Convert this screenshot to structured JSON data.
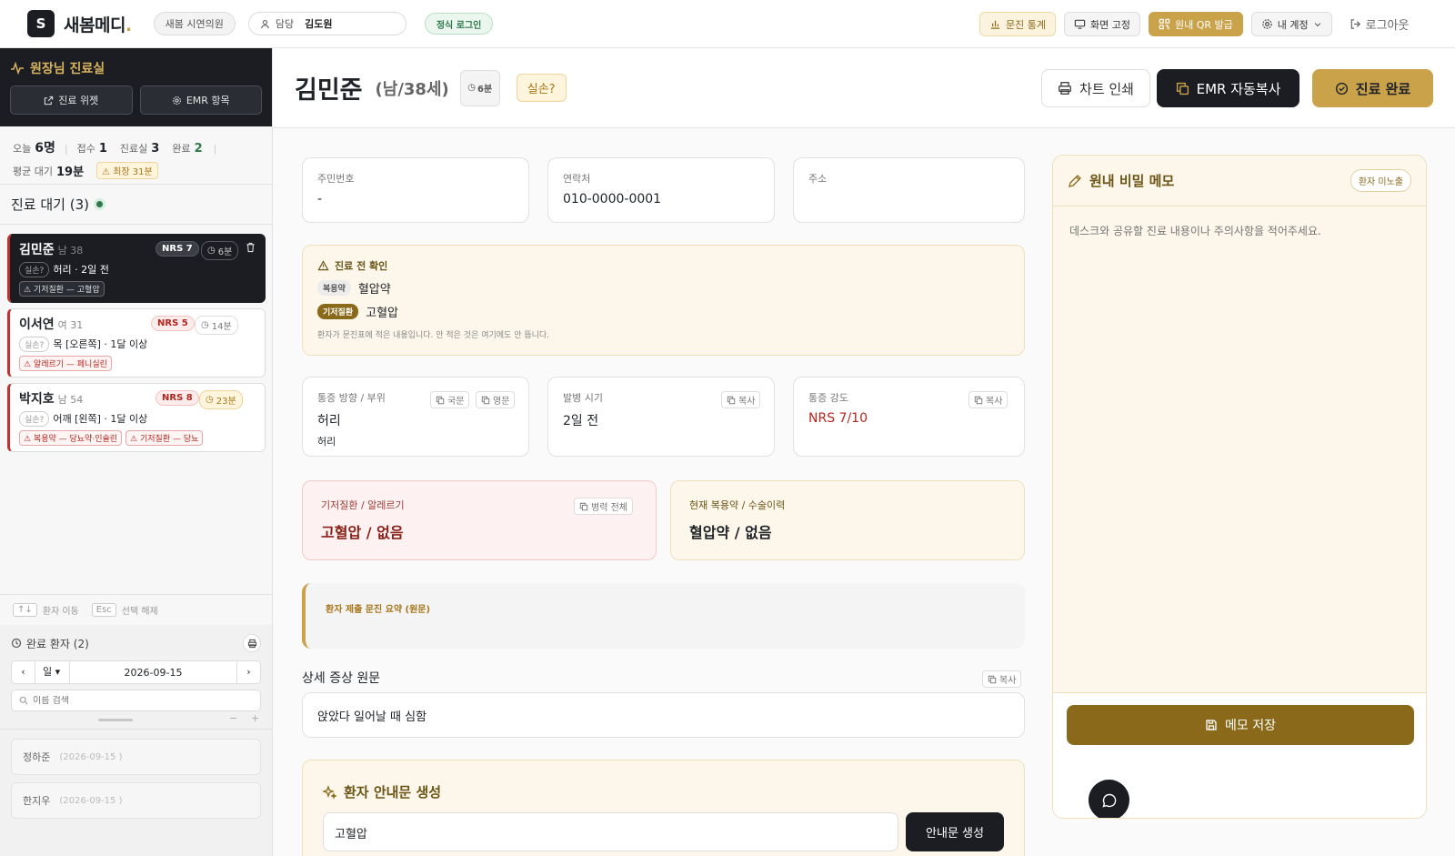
{
  "topbar": {
    "logo_letter": "S",
    "brand": "새봄메디",
    "brand_dot": ".",
    "clinic": "새봄 시연의원",
    "staff_label": "담당",
    "staff_name": "김도원",
    "login_badge": "정식 로그인",
    "btn_stats": "문진 통계",
    "btn_fix": "화면 고정",
    "btn_qr": "원내 QR 발급",
    "btn_account": "내 계정",
    "btn_logout": "로그아웃"
  },
  "sidebar": {
    "room_title": "원장님 진료실",
    "btn_widget": "진료 위젯",
    "btn_emr": "EMR 항목",
    "stats": {
      "today_label": "오늘",
      "today": "6명",
      "recv_label": "접수",
      "recv": "1",
      "room_label": "진료실",
      "room": "3",
      "done_label": "완료",
      "done": "2",
      "avg_label": "평균 대기",
      "avg": "19분",
      "max": "최장 31분"
    },
    "queue_title": "진료 대기 (3)",
    "patients": [
      {
        "name": "김민준",
        "meta": "남 38",
        "nrs": "NRS 7",
        "wait": "6분",
        "ins": "실손?",
        "complaint": "허리 · 2일 전",
        "tags": [
          "⚠ 기저질환 — 고혈압"
        ]
      },
      {
        "name": "이서연",
        "meta": "여 31",
        "nrs": "NRS 5",
        "wait": "14분",
        "ins": "실손?",
        "complaint": "목 [오른쪽] · 1달 이상",
        "tags": [
          "⚠ 알레르기 — 페니실린"
        ]
      },
      {
        "name": "박지호",
        "meta": "남 54",
        "nrs": "NRS 8",
        "wait": "23분",
        "ins": "실손?",
        "complaint": "어깨 [왼쪽] · 1달 이상",
        "tags": [
          "⚠ 복용약 — 당뇨약·인슐린",
          "⚠ 기저질환 — 당뇨"
        ]
      }
    ],
    "hint_move_key": "↑↓",
    "hint_move": "환자 이동",
    "hint_esc_key": "Esc",
    "hint_esc": "선택 해제",
    "done_title": "완료 환자 (2)",
    "date_unit": "일",
    "date": "2026-09-15",
    "search_placeholder": "이름 검색",
    "done_list": [
      {
        "name": "정하준",
        "date": "(2026-09-15 )"
      },
      {
        "name": "한지우",
        "date": "(2026-09-15 )"
      }
    ]
  },
  "header": {
    "name": "김민준",
    "info": "(남/38세)",
    "wait": "6분",
    "ins": "실손?",
    "btn_print": "차트 인쇄",
    "btn_emr": "EMR 자동복사",
    "btn_done": "진료 완료"
  },
  "main": {
    "rrn_label": "주민번호",
    "rrn": "-",
    "phone_label": "연락처",
    "phone": "010-0000-0001",
    "addr_label": "주소",
    "addr": "",
    "pre_title": "진료 전 확인",
    "pre_med_tag": "복용약",
    "pre_med": "혈압약",
    "pre_dis_tag": "기저질환",
    "pre_dis": "고혈압",
    "pre_note": "환자가 문진표에 적은 내용입니다. 안 적은 것은 여기에도 안 뜹니다.",
    "pain_label": "통증 방향 / 부위",
    "pain_val": "허리",
    "pain_sub": "허리",
    "copy_kr": "국문",
    "copy_en": "영문",
    "onset_label": "발병 시기",
    "onset_val": "2일 전",
    "copy": "복사",
    "nrs_label": "통증 강도",
    "nrs_val": "NRS 7/10",
    "hist_label": "기저질환 / 알레르기",
    "hist_val": "고혈압 / 없음",
    "hist_copy": "병력 전체",
    "med_label": "현재 복용약 / 수술이력",
    "med_val": "혈압약 / 없음",
    "summary_label": "환자 제출 문진 요약 (원문)",
    "detail_title": "상세 증상 원문",
    "detail_text": "앉았다 일어날 때 심함",
    "guide_title": "환자 안내문 생성",
    "guide_input": "고혈압",
    "guide_btn": "안내문 생성"
  },
  "memo": {
    "title": "원내 비밀 메모",
    "badge": "환자 미노출",
    "placeholder": "데스크와 공유할 진료 내용이나 주의사항을 적어주세요.",
    "save": "메모 저장"
  },
  "colors": {
    "dark": "#1b1d22",
    "gold": "#c9a24a",
    "gold_dark": "#9a7419",
    "red": "#b3261e",
    "cream": "#fcf7ea"
  }
}
